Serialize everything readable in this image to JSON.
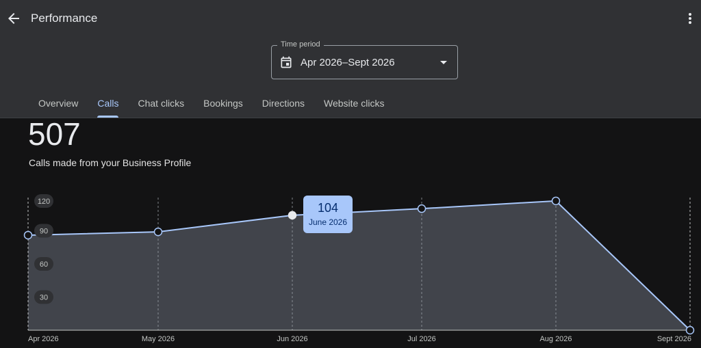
{
  "header": {
    "title": "Performance"
  },
  "time_period": {
    "label": "Time period",
    "value": "Apr 2026–Sept 2026"
  },
  "tabs": [
    {
      "label": "Overview",
      "active": false
    },
    {
      "label": "Calls",
      "active": true
    },
    {
      "label": "Chat clicks",
      "active": false
    },
    {
      "label": "Bookings",
      "active": false
    },
    {
      "label": "Directions",
      "active": false
    },
    {
      "label": "Website clicks",
      "active": false
    }
  ],
  "summary": {
    "total": "507",
    "caption": "Calls made from your Business Profile"
  },
  "tooltip": {
    "value": "104",
    "label": "June 2026"
  },
  "colors": {
    "accent": "#a8c7fa",
    "area_fill": "#4a4e55",
    "background": "#131314",
    "header": "#303134"
  },
  "icons": {
    "back": "back-arrow-icon",
    "more": "more-vert-icon",
    "calendar": "calendar-icon",
    "dropdown": "dropdown-arrow-icon"
  },
  "chart_data": {
    "type": "area",
    "x": [
      "Apr 2026",
      "May 2026",
      "Jun 2026",
      "Jul 2026",
      "Aug 2026",
      "Sept 2026"
    ],
    "values": [
      86,
      89,
      104,
      110,
      117,
      0
    ],
    "y_ticks": [
      30,
      60,
      90,
      120
    ],
    "ylim": [
      0,
      120
    ],
    "highlighted_index": 2
  }
}
